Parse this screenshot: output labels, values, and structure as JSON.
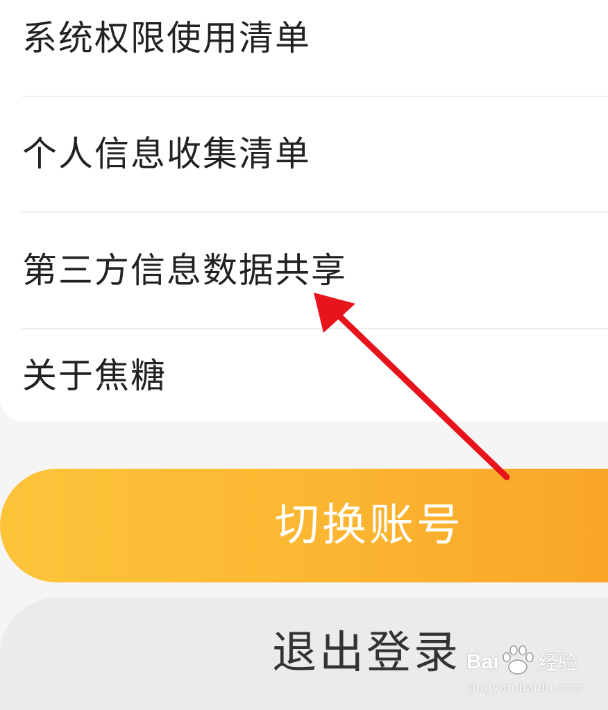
{
  "settings": {
    "items": [
      {
        "label": "系统权限使用清单"
      },
      {
        "label": "个人信息收集清单"
      },
      {
        "label": "第三方信息数据共享"
      },
      {
        "label": "关于焦糖"
      }
    ]
  },
  "buttons": {
    "switch_account": "切换账号",
    "logout": "退出登录"
  },
  "watermark": {
    "brand": "Bai",
    "brand_suffix": "经验",
    "url": "jingyan.baidu.com"
  },
  "colors": {
    "accent_start": "#fdc43a",
    "accent_end": "#f9a528",
    "annotation_arrow": "#e8141b"
  },
  "icons": {
    "annotation": "red-arrow-icon",
    "watermark": "paw-icon"
  }
}
